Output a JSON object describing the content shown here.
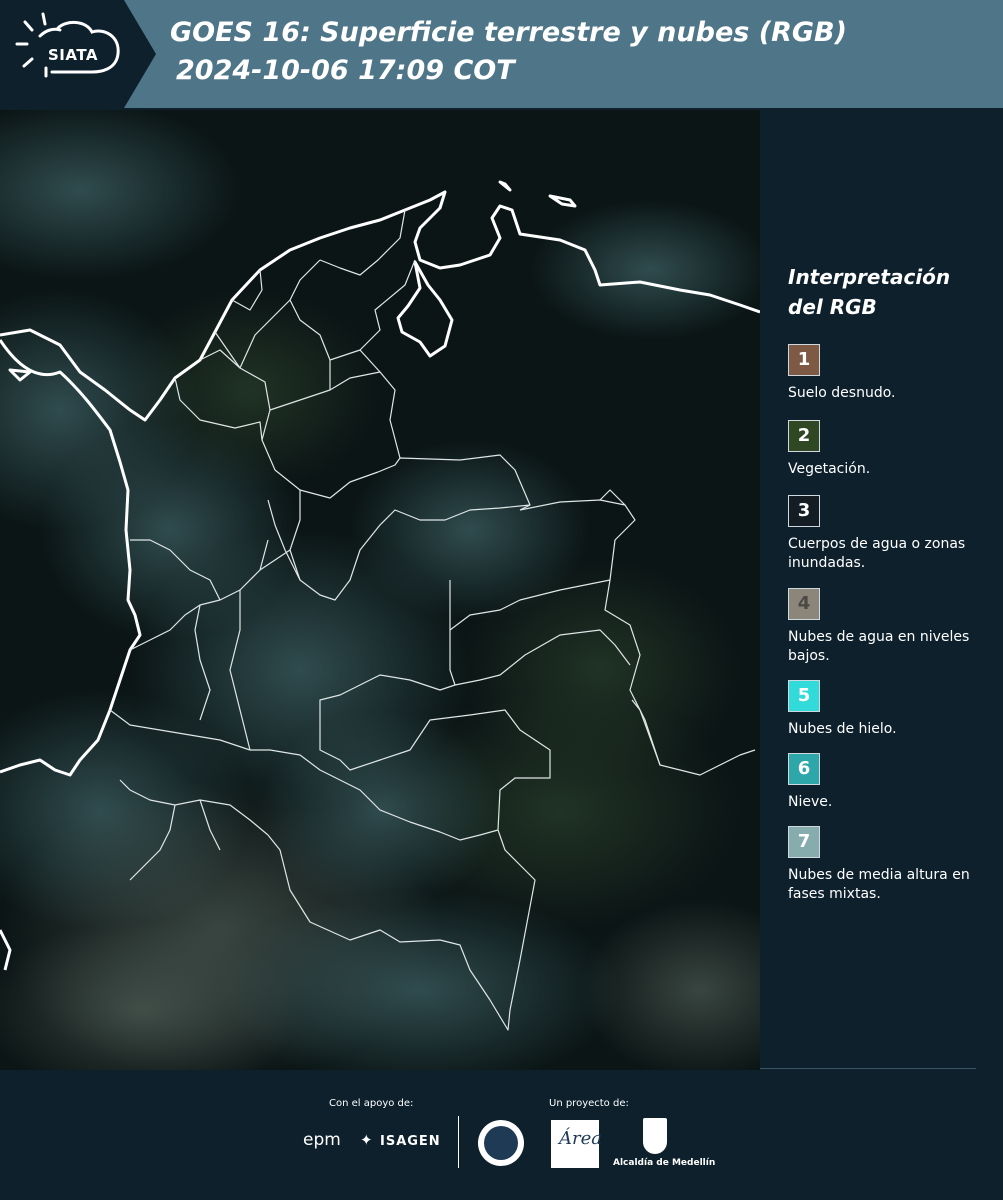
{
  "header": {
    "logo_text": "SIATA",
    "title_line1": "GOES 16: Superficie terrestre y nubes (RGB)",
    "title_line2": "2024-10-06 17:09 COT"
  },
  "legend": {
    "title_line1": "Interpretación",
    "title_line2": "del RGB",
    "items": [
      {
        "number": "1",
        "label": "Suelo desnudo.",
        "color": "#7e5a45"
      },
      {
        "number": "2",
        "label": "Vegetación.",
        "color": "#2f4722"
      },
      {
        "number": "3",
        "label": "Cuerpos de agua o zonas inundadas.",
        "color": "#141c24"
      },
      {
        "number": "4",
        "label": "Nubes de agua en niveles bajos.",
        "color": "#8c857a"
      },
      {
        "number": "5",
        "label": "Nubes de hielo.",
        "color": "#32dbd9"
      },
      {
        "number": "6",
        "label": "Nieve.",
        "color": "#2ea7ab"
      },
      {
        "number": "7",
        "label": "Nubes de media altura en fases mixtas.",
        "color": "#86acae"
      }
    ]
  },
  "footer": {
    "support_label": "Con el apoyo de:",
    "project_label": "Un proyecto de:",
    "epm": "epm",
    "isagen": "ISAGEN",
    "area_text": "Área",
    "alcaldia": "Alcaldía de Medellín"
  }
}
